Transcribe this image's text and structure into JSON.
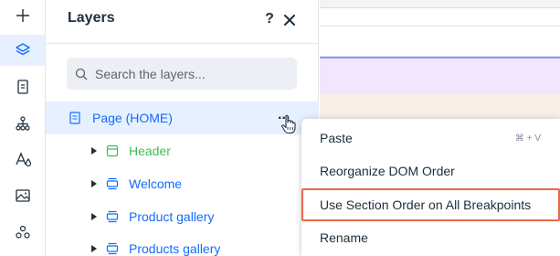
{
  "rail": {
    "items": [
      {
        "name": "add-icon",
        "active": false
      },
      {
        "name": "layers-icon",
        "active": true
      },
      {
        "name": "pages-icon",
        "active": false
      },
      {
        "name": "sitemap-icon",
        "active": false
      },
      {
        "name": "theme-icon",
        "active": false
      },
      {
        "name": "media-icon",
        "active": false
      },
      {
        "name": "apps-icon",
        "active": false
      }
    ]
  },
  "panel": {
    "title": "Layers",
    "help_label": "?",
    "search_placeholder": "Search the layers...",
    "tree": [
      {
        "label": "Page (HOME)",
        "icon": "page-icon",
        "color": "blue",
        "selected": true,
        "has_caret": false
      },
      {
        "label": "Header",
        "icon": "header-icon",
        "color": "green",
        "selected": false,
        "has_caret": true
      },
      {
        "label": "Welcome",
        "icon": "section-icon",
        "color": "blue",
        "selected": false,
        "has_caret": true
      },
      {
        "label": "Product gallery",
        "icon": "section-icon",
        "color": "blue",
        "selected": false,
        "has_caret": true
      },
      {
        "label": "Products gallery",
        "icon": "section-icon",
        "color": "blue",
        "selected": false,
        "has_caret": true
      }
    ],
    "more_label": "..."
  },
  "context_menu": {
    "items": [
      {
        "label": "Paste",
        "shortcut": "⌘ + V"
      },
      {
        "label": "Reorganize DOM Order",
        "shortcut": ""
      },
      {
        "label": "Use Section Order on All Breakpoints",
        "shortcut": "",
        "highlighted": true
      },
      {
        "label": "Rename",
        "shortcut": ""
      }
    ]
  },
  "colors": {
    "accent": "#116dff",
    "selected_row": "#e7f0ff",
    "header_green": "#3cbf55",
    "highlight_outline": "#e8684a",
    "canvas_purple": "#f1e6fb",
    "canvas_beige": "#f9efe9"
  }
}
